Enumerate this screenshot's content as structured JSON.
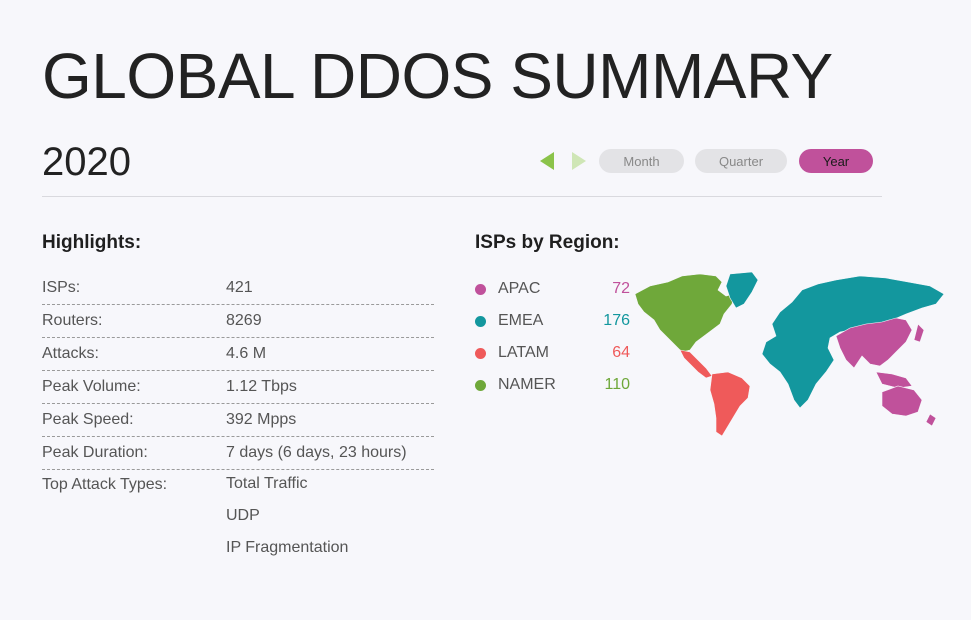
{
  "header": {
    "title": "GLOBAL DDOS SUMMARY",
    "year": "2020"
  },
  "nav": {
    "periods": [
      "Month",
      "Quarter",
      "Year"
    ],
    "selected": "Year"
  },
  "highlights": {
    "title": "Highlights:",
    "rows": [
      {
        "label": "ISPs:",
        "value": "421"
      },
      {
        "label": "Routers:",
        "value": "8269"
      },
      {
        "label": "Attacks:",
        "value": "4.6 M"
      },
      {
        "label": "Peak Volume:",
        "value": "1.12 Tbps"
      },
      {
        "label": "Peak Speed:",
        "value": "392 Mpps"
      },
      {
        "label": "Peak Duration:",
        "value": "7 days (6 days, 23 hours)"
      }
    ],
    "attack_types_label": "Top Attack Types:",
    "attack_types": [
      "Total Traffic",
      "UDP",
      "IP Fragmentation"
    ]
  },
  "regions": {
    "title": "ISPs by Region:",
    "items": [
      {
        "name": "APAC",
        "count": "72",
        "color": "#c0519b"
      },
      {
        "name": "EMEA",
        "count": "176",
        "color": "#13979e"
      },
      {
        "name": "LATAM",
        "count": "64",
        "color": "#ef5a5a"
      },
      {
        "name": "NAMER",
        "count": "110",
        "color": "#6fa83a"
      }
    ]
  },
  "colors": {
    "accent": "#c0519b",
    "nav_arrow": "#8bc34a",
    "apac": "#c0519b",
    "emea": "#13979e",
    "latam": "#ef5a5a",
    "namer": "#6fa83a"
  }
}
